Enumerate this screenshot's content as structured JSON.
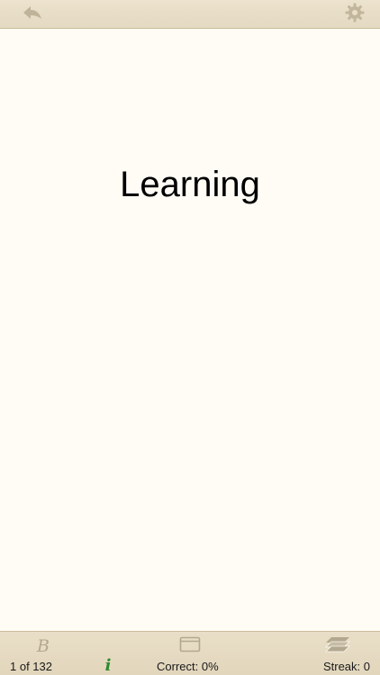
{
  "toolbar_top": {
    "back_icon": "back-arrow-icon",
    "settings_icon": "gear-icon"
  },
  "card": {
    "word": "Learning"
  },
  "toolbar_bottom": {
    "bookmark_glyph": "B",
    "info_glyph": "i",
    "position_text": "1 of 132",
    "correct_text": "Correct: 0%",
    "streak_text": "Streak: 0",
    "card_icon": "card-icon",
    "stack_icon": "stack-icon"
  },
  "colors": {
    "paper": "#fffcf5",
    "toolbar": "#e6dcc4",
    "icon_muted": "#b3a88f",
    "info_green": "#2c8a2c"
  }
}
